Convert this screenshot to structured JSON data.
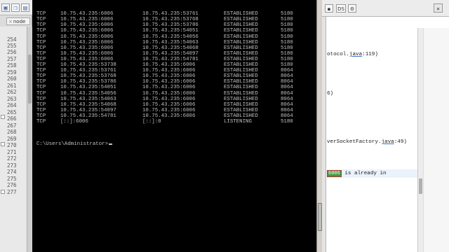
{
  "left_editor": {
    "tab_label": "node",
    "line_numbers": [
      "254",
      "255",
      "256",
      "257",
      "258",
      "259",
      "260",
      "261",
      "262",
      "263",
      "264",
      "265",
      "266",
      "267",
      "268",
      "269",
      "270",
      "271",
      "272",
      "273",
      "274",
      "275",
      "276",
      "277"
    ]
  },
  "console": {
    "rows": [
      {
        "proto": "TCP",
        "local": "10.75.43.235:6006",
        "foreign": "10.75.43.235:53761",
        "state": "ESTABLISHED",
        "pid": "5180"
      },
      {
        "proto": "TCP",
        "local": "10.75.43.235:6006",
        "foreign": "10.75.43.235:53768",
        "state": "ESTABLISHED",
        "pid": "5180"
      },
      {
        "proto": "TCP",
        "local": "10.75.43.235:6006",
        "foreign": "10.75.43.235:53786",
        "state": "ESTABLISHED",
        "pid": "5180"
      },
      {
        "proto": "TCP",
        "local": "10.75.43.235:6006",
        "foreign": "10.75.43.235:54051",
        "state": "ESTABLISHED",
        "pid": "5180"
      },
      {
        "proto": "TCP",
        "local": "10.75.43.235:6006",
        "foreign": "10.75.43.235:54056",
        "state": "ESTABLISHED",
        "pid": "5180"
      },
      {
        "proto": "TCP",
        "local": "10.75.43.235:6006",
        "foreign": "10.75.43.235:54063",
        "state": "ESTABLISHED",
        "pid": "5180"
      },
      {
        "proto": "TCP",
        "local": "10.75.43.235:6006",
        "foreign": "10.75.43.235:54068",
        "state": "ESTABLISHED",
        "pid": "5180"
      },
      {
        "proto": "TCP",
        "local": "10.75.43.235:6006",
        "foreign": "10.75.43.235:54097",
        "state": "ESTABLISHED",
        "pid": "5180"
      },
      {
        "proto": "TCP",
        "local": "10.75.43.235:6006",
        "foreign": "10.75.43.235:54781",
        "state": "ESTABLISHED",
        "pid": "5180"
      },
      {
        "proto": "TCP",
        "local": "10.75.43.235:53738",
        "foreign": "10.75.43.235:6006",
        "state": "ESTABLISHED",
        "pid": "5180"
      },
      {
        "proto": "TCP",
        "local": "10.75.43.235:53761",
        "foreign": "10.75.43.235:6006",
        "state": "ESTABLISHED",
        "pid": "8064"
      },
      {
        "proto": "TCP",
        "local": "10.75.43.235:53768",
        "foreign": "10.75.43.235:6006",
        "state": "ESTABLISHED",
        "pid": "8064"
      },
      {
        "proto": "TCP",
        "local": "10.75.43.235:53786",
        "foreign": "10.75.43.235:6006",
        "state": "ESTABLISHED",
        "pid": "8064"
      },
      {
        "proto": "TCP",
        "local": "10.75.43.235:54051",
        "foreign": "10.75.43.235:6006",
        "state": "ESTABLISHED",
        "pid": "8064"
      },
      {
        "proto": "TCP",
        "local": "10.75.43.235:54056",
        "foreign": "10.75.43.235:6006",
        "state": "ESTABLISHED",
        "pid": "8064"
      },
      {
        "proto": "TCP",
        "local": "10.75.43.235:54063",
        "foreign": "10.75.43.235:6006",
        "state": "ESTABLISHED",
        "pid": "8064"
      },
      {
        "proto": "TCP",
        "local": "10.75.43.235:54068",
        "foreign": "10.75.43.235:6006",
        "state": "ESTABLISHED",
        "pid": "8064"
      },
      {
        "proto": "TCP",
        "local": "10.75.43.235:54097",
        "foreign": "10.75.43.235:6006",
        "state": "ESTABLISHED",
        "pid": "8064"
      },
      {
        "proto": "TCP",
        "local": "10.75.43.235:54781",
        "foreign": "10.75.43.235:6006",
        "state": "ESTABLISHED",
        "pid": "8064"
      },
      {
        "proto": "TCP",
        "local": "[::]:6006",
        "foreign": "[::]:0",
        "state": "LISTENING",
        "pid": "5180"
      }
    ],
    "prompt": "C:\\Users\\Administrator>"
  },
  "right_editor": {
    "toolbar_label": "DS",
    "lines": {
      "protocol": "otocol.",
      "protocol_link": "java",
      "protocol_suffix": ":119)",
      "paren6": "6)",
      "factory": "verSocketFactory.",
      "factory_link": "java",
      "factory_suffix": ":49)",
      "port_badge": "6006",
      "port_text": " is already in"
    }
  },
  "colors": {
    "console_bg": "#000000",
    "console_fg": "#c0c0c0",
    "badge_bg": "#3f9a3f"
  }
}
